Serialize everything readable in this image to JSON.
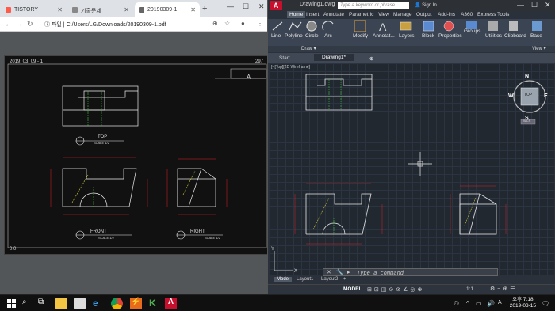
{
  "chrome": {
    "tabs": [
      {
        "label": "TISTORY",
        "active": false
      },
      {
        "label": "기출문제",
        "active": false
      },
      {
        "label": "20190309-1",
        "active": true
      }
    ],
    "new_tab_symbol": "+",
    "window_controls": [
      "—",
      "☐",
      "✕"
    ],
    "address": {
      "scheme_label": "파일",
      "url": "C:/Users/LG/Downloads/20190309-1.pdf"
    }
  },
  "pdf": {
    "date": "2019. 03. 09 - 1",
    "page_num": "297",
    "title_block_letter": "A",
    "views": [
      {
        "label": "TOP",
        "scale": "SCALE 1/2"
      },
      {
        "label": "FRONT",
        "scale": "SCALE 1/2"
      },
      {
        "label": "RIGHT",
        "scale": "SCALE 1/2"
      }
    ],
    "corner_label": "0.0"
  },
  "autocad": {
    "logo": "A",
    "drawing_name": "Drawing1.dwg",
    "search_placeholder": "Type a keyword or phrase",
    "sign_in": "Sign In",
    "ribbon_tabs": [
      "Home",
      "Insert",
      "Annotate",
      "Parametric",
      "View",
      "Manage",
      "Output",
      "Add-ins",
      "A360",
      "Express Tools"
    ],
    "active_ribbon_tab": "Home",
    "tools": [
      "Line",
      "Polyline",
      "Circle",
      "Arc",
      "Modify",
      "Annotat...",
      "Layers",
      "Block",
      "Properties",
      "Groups",
      "Utilities",
      "Clipboard",
      "Base"
    ],
    "panel_labels": [
      "Draw ▾",
      "View ▾"
    ],
    "doc_tabs": [
      "Start",
      "Drawing1*"
    ],
    "active_doc_tab": "Drawing1*",
    "viewport_label": "[-][Top][2D Wireframe]",
    "viewcube": {
      "n": "N",
      "s": "S",
      "e": "E",
      "w": "W",
      "face": "TOP",
      "wcs": "WCS"
    },
    "command_placeholder": "Type a command",
    "layout_tabs": [
      "Model",
      "Layout1",
      "Layout2"
    ],
    "active_layout_tab": "Model",
    "status_model": "MODEL",
    "status_scale": "1:1"
  },
  "taskbar": {
    "time": "오후 7:18",
    "date": "2019-03-15"
  },
  "colors": {
    "cad_red": "#e0202a",
    "cad_white": "#e8e8e8",
    "cad_yellow": "#d7d43a",
    "cad_green": "#3fbf3f",
    "accent_ribbon": "#3b4453"
  }
}
